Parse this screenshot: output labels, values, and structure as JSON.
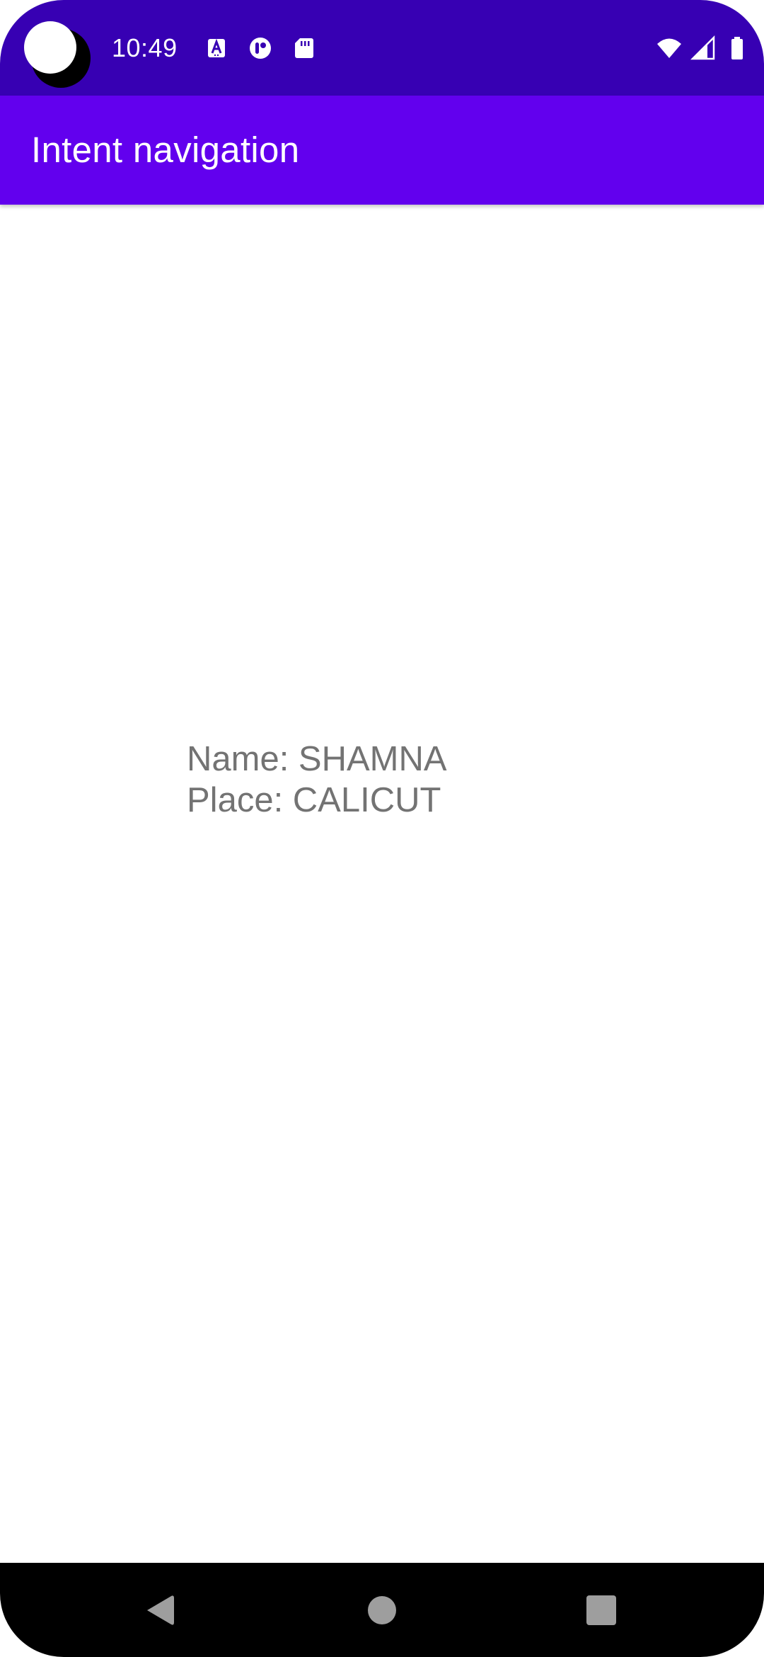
{
  "status_bar": {
    "time": "10:49",
    "left_icons": [
      "notification-a-icon",
      "notification-app-icon",
      "sd-card-icon"
    ],
    "right_icons": [
      "wifi-icon",
      "cellular-signal-icon",
      "battery-icon"
    ],
    "color": "#3700b3"
  },
  "app_bar": {
    "title": "Intent navigation",
    "color": "#6200ee"
  },
  "content": {
    "name_line": "Name: SHAMNA",
    "place_line": "Place: CALICUT",
    "text_color": "#737373"
  },
  "nav_bar": {
    "buttons": [
      "back-icon",
      "home-icon",
      "recents-icon"
    ]
  }
}
